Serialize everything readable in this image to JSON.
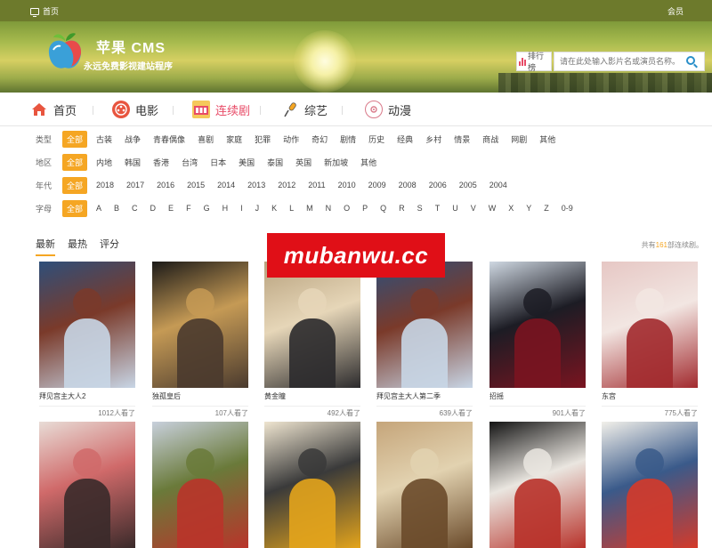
{
  "topbar": {
    "home_label": "首页",
    "member_label": "会员"
  },
  "brand": {
    "name": "苹果 CMS",
    "slogan": "永远免费影视建站程序"
  },
  "search": {
    "rank_label": "排行榜",
    "placeholder": "请在此处输入影片名或演员名称。"
  },
  "nav": [
    {
      "label": "首页",
      "icon": "home-icon"
    },
    {
      "label": "电影",
      "icon": "film-reel-icon"
    },
    {
      "label": "连续剧",
      "icon": "tv-series-icon"
    },
    {
      "label": "综艺",
      "icon": "microphone-icon"
    },
    {
      "label": "动漫",
      "icon": "anime-icon"
    }
  ],
  "filters": {
    "type": {
      "label": "类型",
      "options": [
        "全部",
        "古装",
        "战争",
        "青春偶像",
        "喜剧",
        "家庭",
        "犯罪",
        "动作",
        "奇幻",
        "剧情",
        "历史",
        "经典",
        "乡村",
        "情景",
        "商战",
        "网剧",
        "其他"
      ]
    },
    "region": {
      "label": "地区",
      "options": [
        "全部",
        "内地",
        "韩国",
        "香港",
        "台湾",
        "日本",
        "美国",
        "泰国",
        "英国",
        "新加坡",
        "其他"
      ]
    },
    "year": {
      "label": "年代",
      "options": [
        "全部",
        "2018",
        "2017",
        "2016",
        "2015",
        "2014",
        "2013",
        "2012",
        "2011",
        "2010",
        "2009",
        "2008",
        "2006",
        "2005",
        "2004"
      ]
    },
    "letter": {
      "label": "字母",
      "options": [
        "全部",
        "A",
        "B",
        "C",
        "D",
        "E",
        "F",
        "G",
        "H",
        "I",
        "J",
        "K",
        "L",
        "M",
        "N",
        "O",
        "P",
        "Q",
        "R",
        "S",
        "T",
        "U",
        "V",
        "W",
        "X",
        "Y",
        "Z",
        "0-9"
      ]
    }
  },
  "sort_tabs": [
    "最新",
    "最热",
    "评分"
  ],
  "total": {
    "prefix": "共有",
    "count": "161",
    "suffix": "部连续剧。"
  },
  "watermark": "mubanwu.cc",
  "videos": [
    {
      "title": "拜见宫主大人2",
      "views": "1012人看了",
      "colors": [
        "#2e4f7a",
        "#c8d6e6",
        "#7a3a2a"
      ]
    },
    {
      "title": "独孤皇后",
      "views": "107人看了",
      "colors": [
        "#1c1a18",
        "#4a3a2e",
        "#c59a55"
      ]
    },
    {
      "title": "黄金瞳",
      "views": "492人看了",
      "colors": [
        "#b8a27e",
        "#2b2a2c",
        "#e6d6b8"
      ]
    },
    {
      "title": "拜见宫主大人第二季",
      "views": "639人看了",
      "colors": [
        "#2e4f7a",
        "#c8d6e6",
        "#7a3a2a"
      ]
    },
    {
      "title": "招摇",
      "views": "901人看了",
      "colors": [
        "#cfd8e2",
        "#7a1420",
        "#1c1c24"
      ]
    },
    {
      "title": "东宫",
      "views": "775人看了",
      "colors": [
        "#e6c7c4",
        "#a22a2e",
        "#f2e6e2"
      ]
    },
    {
      "title": "",
      "views": "",
      "colors": [
        "#e8dcd6",
        "#3a2a2a",
        "#d06a6a"
      ]
    },
    {
      "title": "",
      "views": "",
      "colors": [
        "#c8d0dc",
        "#b9342a",
        "#6a7a3a"
      ]
    },
    {
      "title": "",
      "views": "",
      "colors": [
        "#efe5d0",
        "#e3a41c",
        "#3a3a3a"
      ]
    },
    {
      "title": "",
      "views": "",
      "colors": [
        "#c5a57a",
        "#6a4a2a",
        "#e2d2b0"
      ]
    },
    {
      "title": "",
      "views": "",
      "colors": [
        "#141414",
        "#b8322a",
        "#eae6e0"
      ]
    },
    {
      "title": "",
      "views": "",
      "colors": [
        "#f2f0ea",
        "#d43a2a",
        "#3a5a8a"
      ]
    }
  ]
}
